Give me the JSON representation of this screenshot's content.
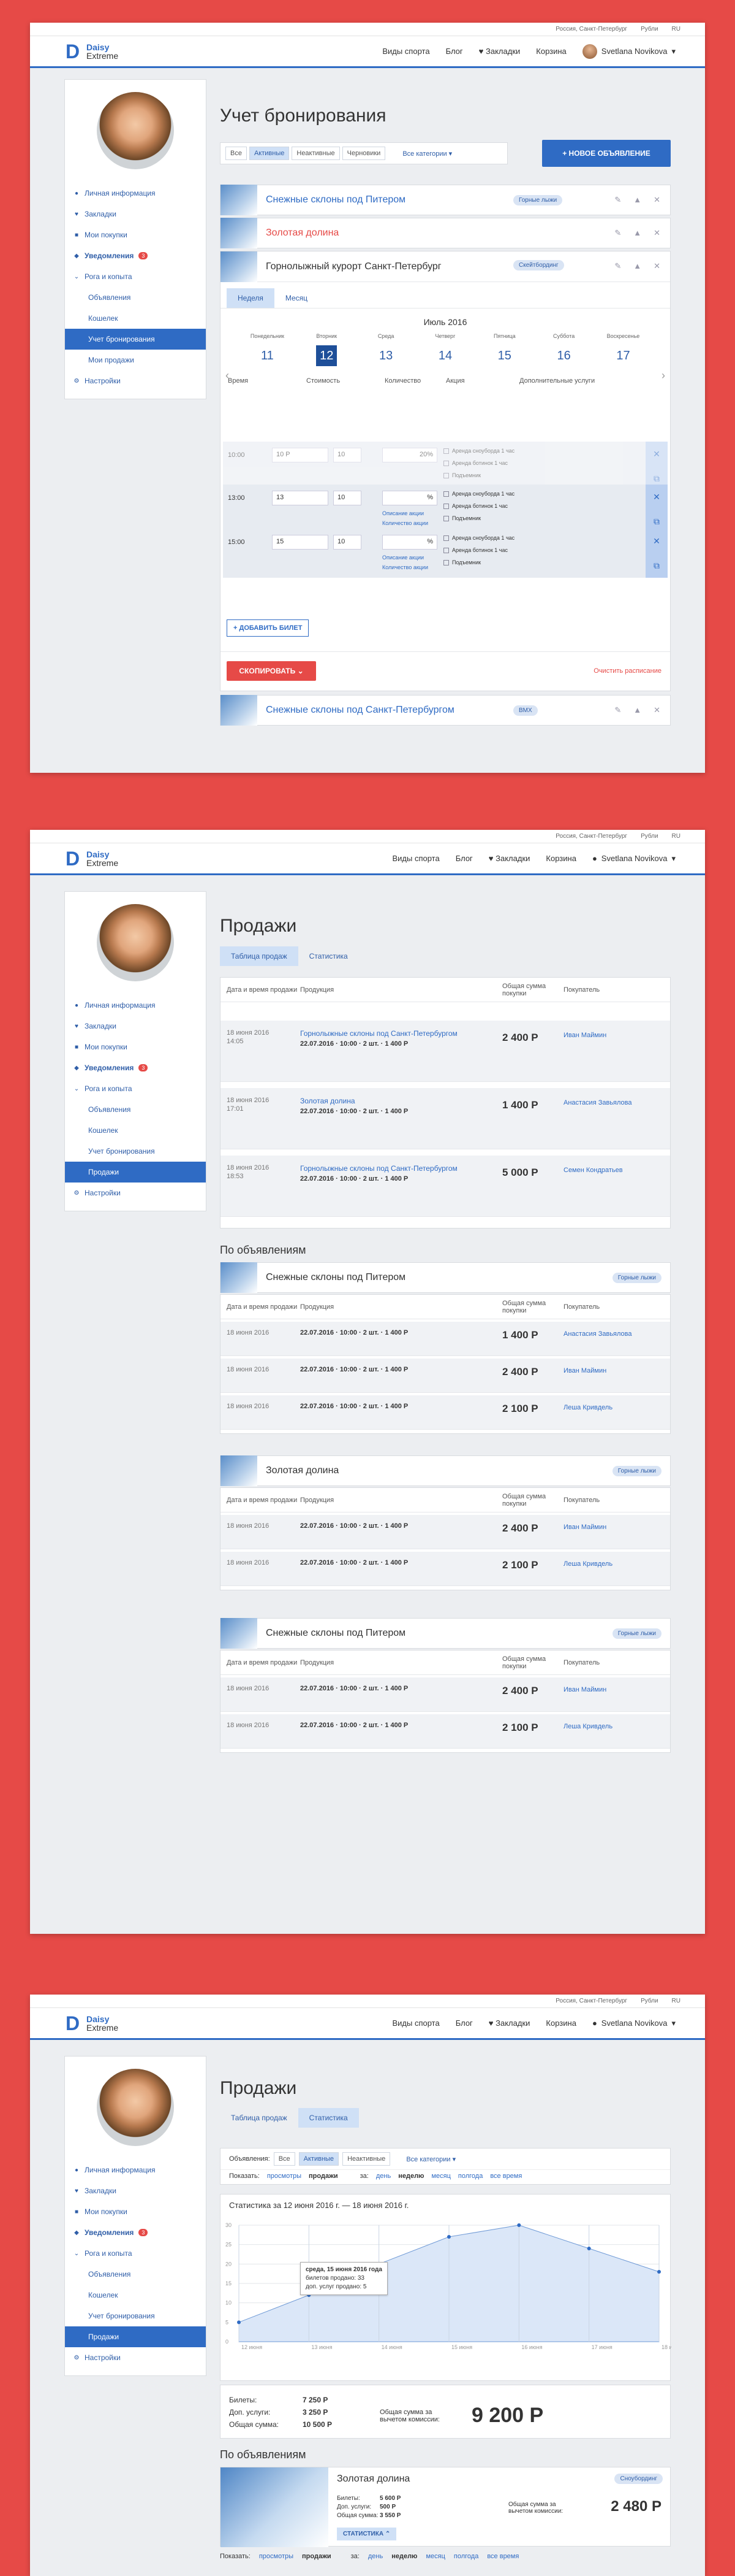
{
  "topbar": {
    "location": "Россия, Санкт-Петербург",
    "currency": "Рубли",
    "lang": "RU"
  },
  "header": {
    "brand_top": "Daisy",
    "brand_bottom": "Extreme",
    "nav": [
      "Виды спорта",
      "Блог",
      "Закладки",
      "Корзина"
    ],
    "user": "Svetlana Novikova"
  },
  "sidebar": {
    "items": [
      {
        "label": "Личная информация",
        "icon": "user-icon"
      },
      {
        "label": "Закладки",
        "icon": "heart-icon"
      },
      {
        "label": "Мои покупки",
        "icon": "cart-icon"
      },
      {
        "label": "Уведомления",
        "icon": "bell-icon",
        "badge": "3"
      },
      {
        "label": "Рога и копыта",
        "icon": "chevron-down-icon"
      }
    ],
    "sub1": [
      "Объявления",
      "Кошелек",
      "Учет бронирования",
      "Мои продажи"
    ],
    "sub2": [
      "Объявления",
      "Кошелек",
      "Учет бронирования",
      "Продажи"
    ],
    "settings": "Настройки"
  },
  "s1": {
    "title": "Учет бронирования",
    "filters": [
      "Все",
      "Активные",
      "Неактивные",
      "Черновики"
    ],
    "category": "Все категории",
    "new_btn": "+ НОВОЕ ОБЪЯВЛЕНИЕ",
    "ads": [
      {
        "title": "Снежные склоны под Питером",
        "tag": "Горные лыжи"
      },
      {
        "title": "Золотая долина",
        "tag": ""
      },
      {
        "title": "Горнолыжный курорт Санкт-Петербург",
        "tag": "Скейтбординг"
      }
    ],
    "tabs": [
      "Неделя",
      "Месяц"
    ],
    "month": "Июль 2016",
    "days": [
      {
        "name": "Понедельник",
        "num": "11"
      },
      {
        "name": "Вторник",
        "num": "12"
      },
      {
        "name": "Среда",
        "num": "13"
      },
      {
        "name": "Четверг",
        "num": "14"
      },
      {
        "name": "Пятница",
        "num": "15"
      },
      {
        "name": "Суббота",
        "num": "16"
      },
      {
        "name": "Воскресенье",
        "num": "17"
      }
    ],
    "cols": [
      "Время",
      "Стоимость",
      "Количество",
      "Акция",
      "Дополнительные услуги"
    ],
    "slots": [
      {
        "time": "10:00",
        "price": "10 Р",
        "qty": "10",
        "promo": "20%",
        "extra1": "Аренда сноуборда 1 час",
        "extra2": "Аренда ботинок 1 час",
        "extra3": "Подъемник"
      },
      {
        "time": "13:00",
        "price": "13",
        "qty": "10",
        "promo": "%",
        "extra1": "Аренда сноуборда 1 час",
        "extra2": "Аренда ботинок 1 час",
        "extra3": "Подъемник"
      },
      {
        "time": "15:00",
        "price": "15",
        "qty": "10",
        "promo": "%",
        "extra1": "Аренда сноуборда 1 час",
        "extra2": "Аренда ботинок 1 час",
        "extra3": "Подъемник"
      }
    ],
    "promo_link1": "Описание акции",
    "promo_link2": "Количество акции",
    "add_ticket": "+ ДОБАВИТЬ БИЛЕТ",
    "copy_btn": "СКОПИРОВАТЬ",
    "clear": "Очистить расписание",
    "last_ad": {
      "title": "Снежные склоны под Санкт-Петербургом",
      "tag": "BMX"
    }
  },
  "s2": {
    "title": "Продажи",
    "tabs": [
      "Таблица продаж",
      "Статистика"
    ],
    "cols": [
      "Дата и время продажи",
      "Продукция",
      "Общая сумма покупки",
      "Покупатель"
    ],
    "rows": [
      {
        "date": "18 июня 2016",
        "time": "14:05",
        "product": "Горнолыжные склоны под Санкт-Петербургом",
        "line": "22.07.2016 · 10:00 · 2 шт. · 1 400 Р",
        "amount": "2 400 Р",
        "buyer": "Иван Маймин"
      },
      {
        "date": "18 июня 2016",
        "time": "17:01",
        "product": "Золотая долина",
        "line": "22.07.2016 · 10:00 · 2 шт. · 1 400 Р",
        "amount": "1 400 Р",
        "buyer": "Анастасия Завьялова"
      },
      {
        "date": "18 июня 2016",
        "time": "18:53",
        "product": "Горнолыжные склоны под Санкт-Петербургом",
        "line": "22.07.2016 · 10:00 · 2 шт. · 1 400 Р",
        "amount": "5 000 Р",
        "buyer": "Семен Кондратьев"
      }
    ],
    "by_ads": "По объявлениям",
    "ad1": {
      "title": "Снежные склоны под Питером",
      "tag": "Горные лыжи",
      "amounts": [
        "1 400 Р",
        "2 400 Р",
        "2 100 Р"
      ],
      "buyers": [
        "Анастасия Завьялова",
        "Иван Маймин",
        "Леша Кривдель"
      ]
    },
    "ad2": {
      "title": "Золотая долина",
      "tag": "Горные лыжи",
      "amounts": [
        "2 400 Р",
        "2 100 Р"
      ],
      "buyers": [
        "Иван Маймин",
        "Леша Кривдель"
      ]
    },
    "ad3": {
      "title": "Снежные склоны под Питером",
      "tag": "Горные лыжи",
      "amounts": [
        "2 400 Р",
        "2 100 Р"
      ],
      "buyers": [
        "Иван Маймин",
        "Леша Кривдель"
      ]
    }
  },
  "s3": {
    "title": "Продажи",
    "tabs": [
      "Таблица продаж",
      "Статистика"
    ],
    "ads_label": "Объявления:",
    "filters": [
      "Все",
      "Активные",
      "Неактивные"
    ],
    "category": "Все категории",
    "show": "Показать:",
    "show_opts": [
      "просмотры",
      "продажи"
    ],
    "for": "за:",
    "periods": [
      "день",
      "неделю",
      "месяц",
      "полгода",
      "все время"
    ],
    "stat_title": "Статистика за 12 июня 2016 г. — 18 июня 2016 г.",
    "tooltip": [
      "среда, 15 июня 2016 года",
      "билетов продано: 33",
      "доп. услуг продано: 5"
    ],
    "tickets_l": "Билеты:",
    "tickets_v": "7 250 Р",
    "extra_l": "Доп. услуги:",
    "extra_v": "3 250 Р",
    "total_l": "Общая сумма:",
    "total_v": "10 500 Р",
    "fee_l": "Общая сумма за вычетом комиссии:",
    "fee_v": "9 200 Р",
    "by_ads": "По объявлениям",
    "ad": {
      "title": "Золотая долина",
      "tag": "Сноубординг",
      "t": "5 600 Р",
      "e": "500 Р",
      "s": "3 550 Р",
      "total": "2 480 Р",
      "stats_btn": "СТАТИСТИКА"
    }
  },
  "chart_data": {
    "type": "area",
    "x": [
      "12 июня",
      "13 июня",
      "14 июня",
      "15 июня",
      "16 июня",
      "17 июня",
      "18 июня"
    ],
    "values": [
      5,
      12,
      20,
      27,
      30,
      24,
      18
    ],
    "ylim": [
      0,
      30
    ],
    "yticks": [
      0,
      5,
      10,
      15,
      20,
      25,
      30
    ]
  }
}
